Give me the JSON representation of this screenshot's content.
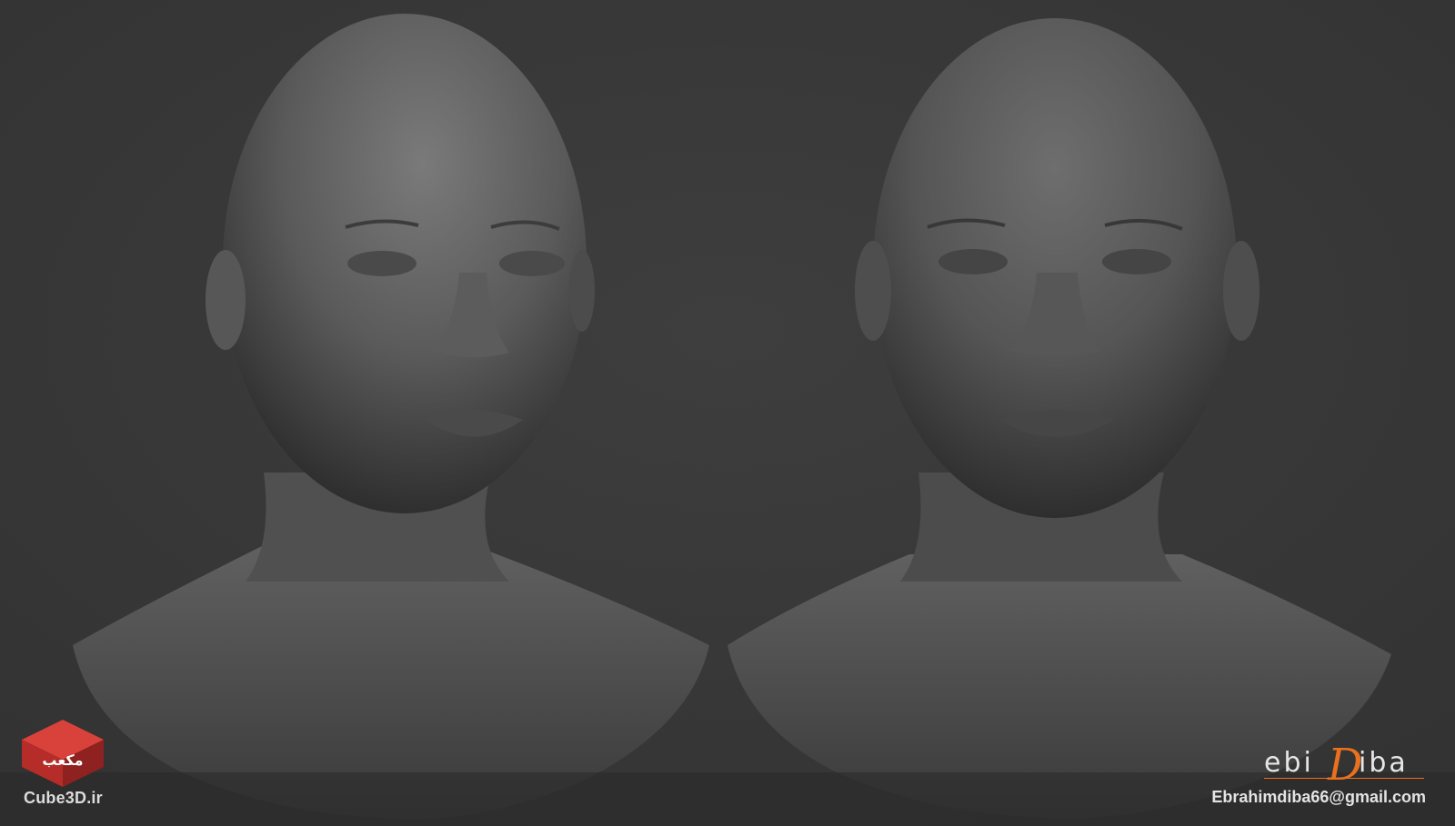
{
  "branding": {
    "site": "Cube3D.ir",
    "logo_icon": "cube-logo-icon",
    "logo_glyph_text": "مکعب",
    "signature_part1": "ebi",
    "signature_accent": "D",
    "signature_part2": "iba",
    "email": "Ebrahimdiba66@gmail.com"
  },
  "colors": {
    "background": "#3a3a3a",
    "sculpt": "#6a6a6a",
    "accent": "#e8701e",
    "logo_red": "#c8302e"
  }
}
